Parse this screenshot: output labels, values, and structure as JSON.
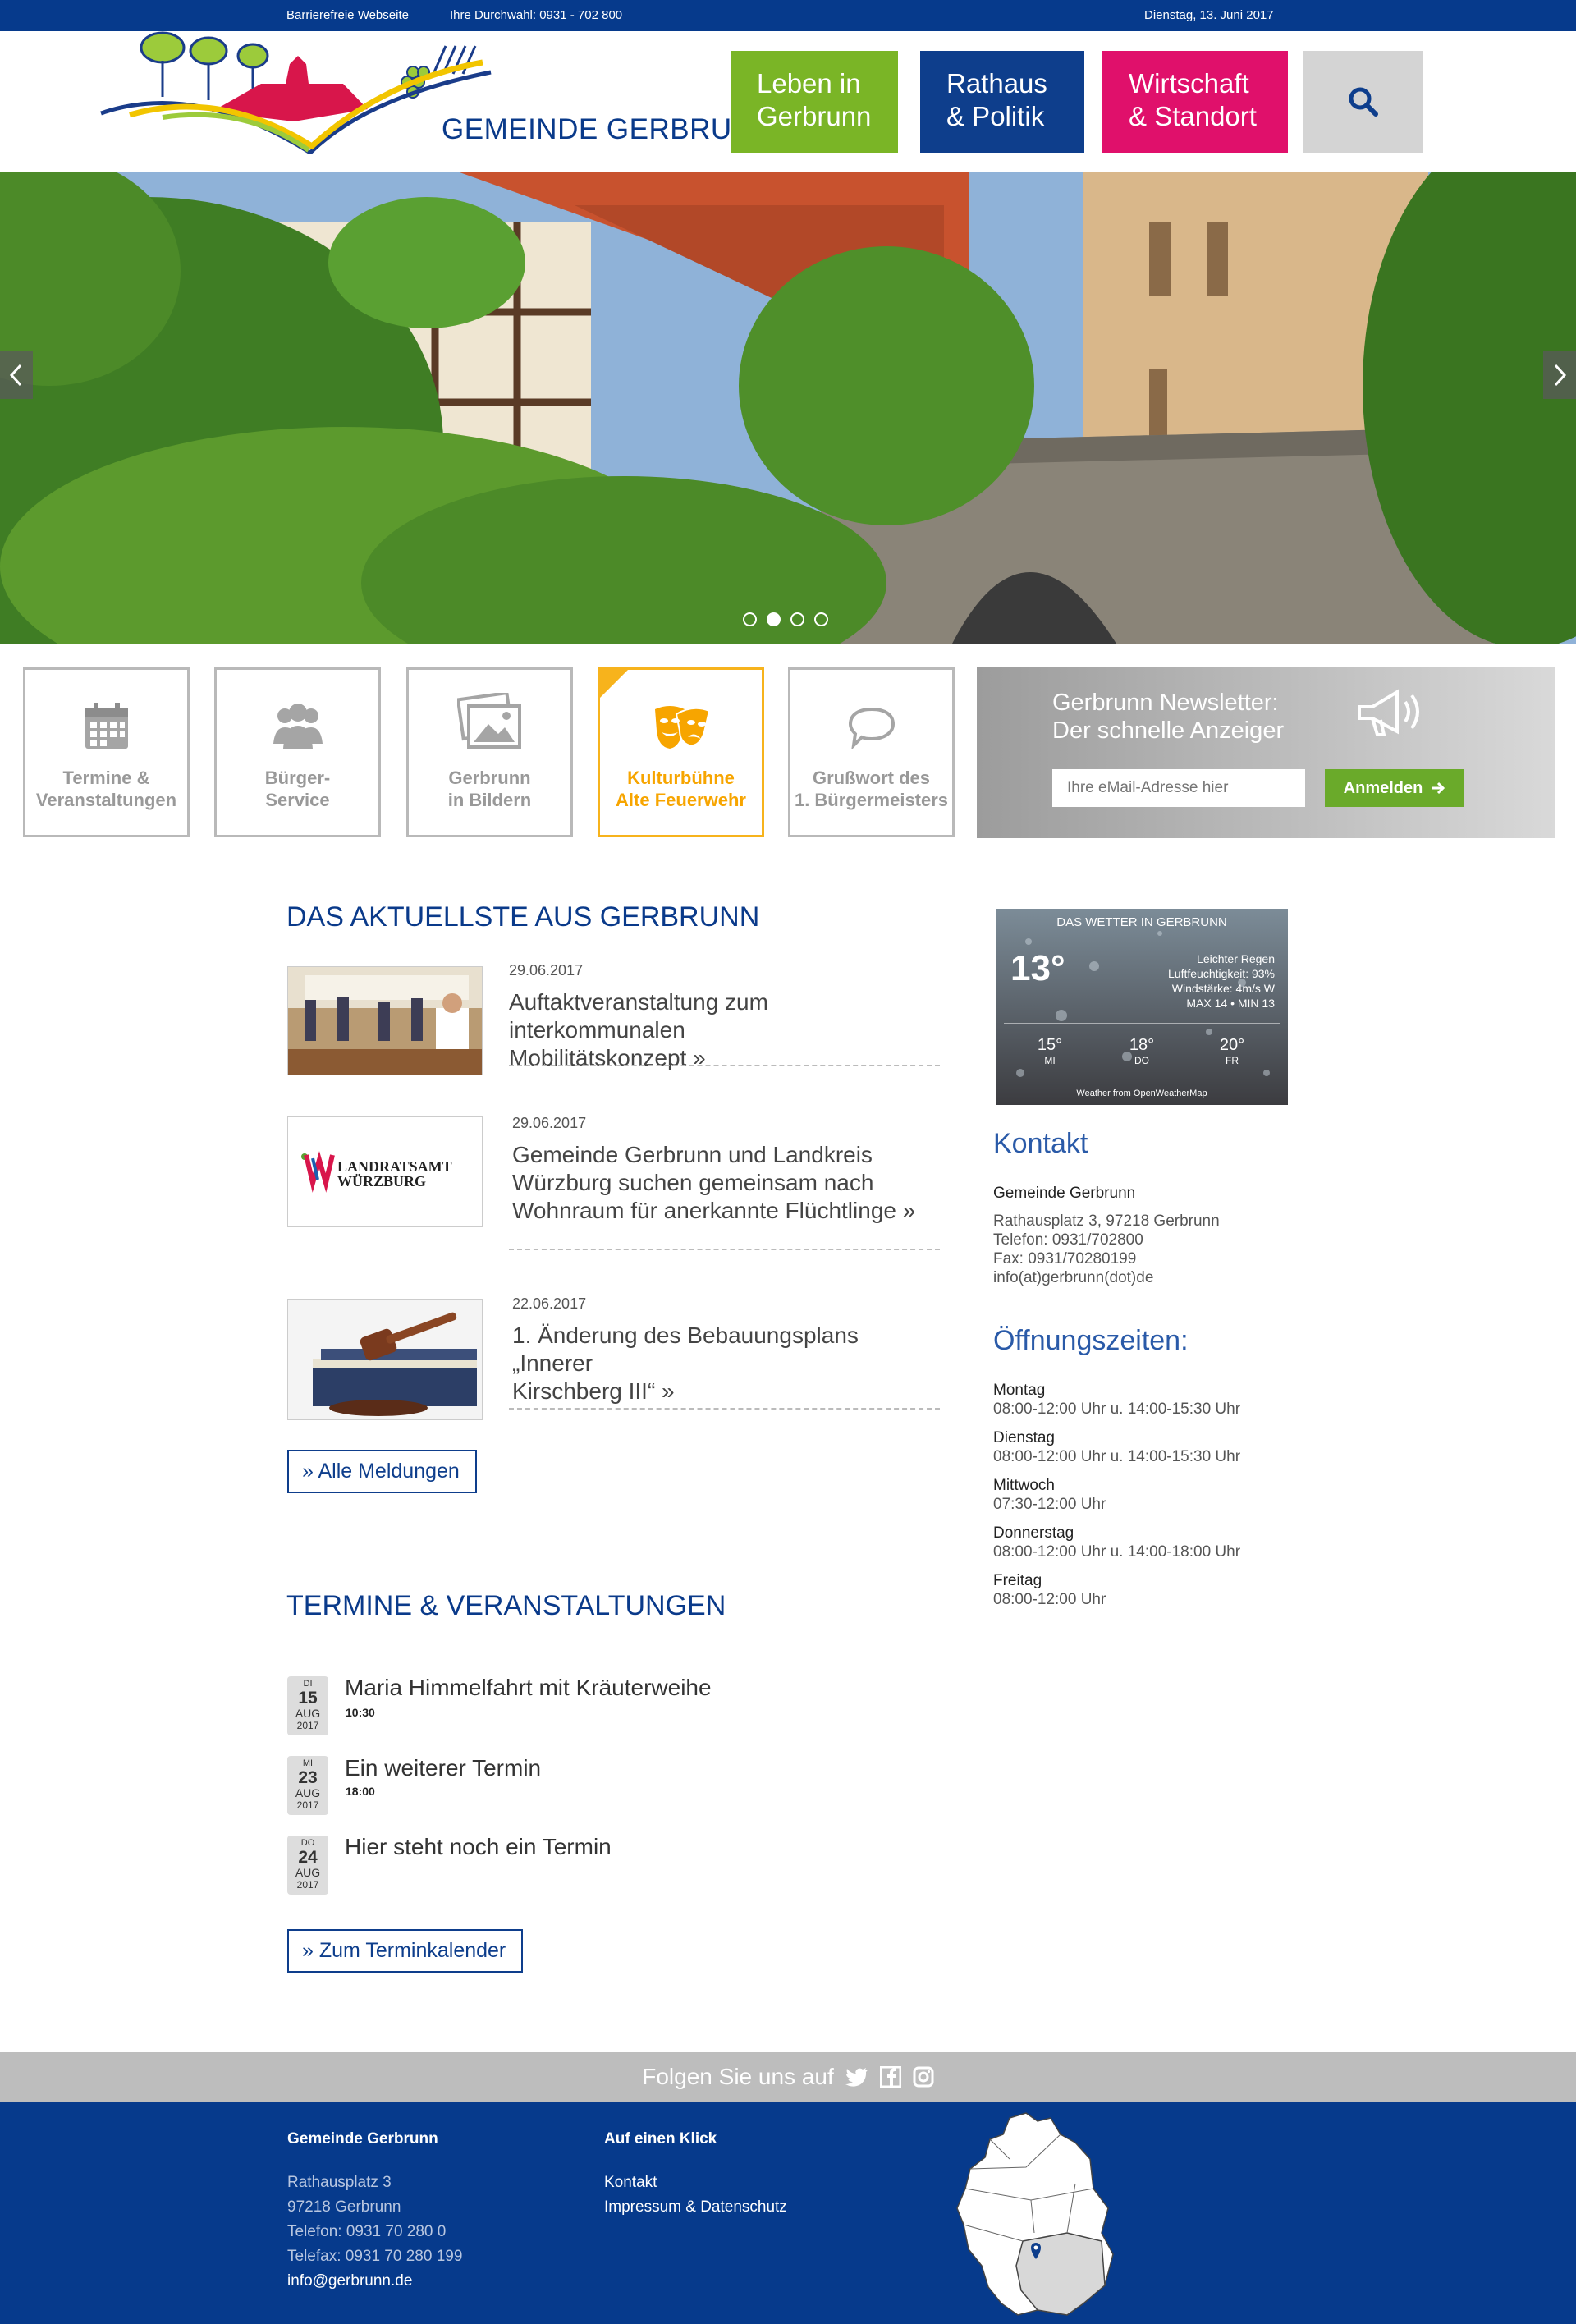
{
  "topbar": {
    "accessible": "Barrierefreie  Webseite",
    "phone": "Ihre Durchwahl: 0931 - 702 800",
    "date": "Dienstag, 13. Juni 2017"
  },
  "header": {
    "logo_text": "GEMEINDE GERBRUNN",
    "nav": [
      {
        "line1": "Leben in",
        "line2": "Gerbrunn"
      },
      {
        "line1": "Rathaus",
        "line2": "& Politik"
      },
      {
        "line1": "Wirtschaft",
        "line2": "& Standort"
      }
    ],
    "search_icon": "search-icon"
  },
  "slider": {
    "slides": 4,
    "active": 2
  },
  "tiles": [
    {
      "line1": "Termine &",
      "line2": "Veranstaltungen",
      "icon": "calendar-icon"
    },
    {
      "line1": "Bürger-",
      "line2": "Service",
      "icon": "people-icon"
    },
    {
      "line1": "Gerbrunn",
      "line2": "in Bildern",
      "icon": "photos-icon"
    },
    {
      "line1": "Kulturbühne",
      "line2": "Alte Feuerwehr",
      "icon": "theater-masks-icon"
    },
    {
      "line1": "Grußwort des",
      "line2": "1. Bürgermeisters",
      "icon": "speech-bubble-icon"
    }
  ],
  "newsletter": {
    "title1": "Gerbrunn Newsletter:",
    "title2": "Der schnelle Anzeiger",
    "placeholder": "Ihre eMail-Adresse hier",
    "button": "Anmelden"
  },
  "news": {
    "heading": "DAS AKTUELLSTE AUS GERBRUNN",
    "items": [
      {
        "date": "29.06.2017",
        "line1": "Auftaktveranstaltung zum interkommunalen",
        "line2": "Mobilitätskonzept »",
        "line3": ""
      },
      {
        "date": "29.06.2017",
        "line1": "Gemeinde Gerbrunn und Landkreis",
        "line2": "Würzburg suchen gemeinsam nach",
        "line3": "Wohnraum für anerkannte Flüchtlinge »",
        "logo_l1": "LANDRATSAMT",
        "logo_l2": "WÜRZBURG"
      },
      {
        "date": "22.06.2017",
        "line1": "1. Änderung des Bebauungsplans „Innerer",
        "line2": "Kirschberg III“  »",
        "line3": ""
      }
    ],
    "all_button": "» Alle Meldungen"
  },
  "events": {
    "heading": "TERMINE & VERANSTALTUNGEN",
    "items": [
      {
        "weekday": "DI",
        "day": "15",
        "month": "AUG",
        "year": "2017",
        "title": "Maria Himmelfahrt mit Kräuterweihe",
        "time": "10:30"
      },
      {
        "weekday": "MI",
        "day": "23",
        "month": "AUG",
        "year": "2017",
        "title": "Ein weiterer Termin",
        "time": "18:00"
      },
      {
        "weekday": "DO",
        "day": "24",
        "month": "AUG",
        "year": "2017",
        "title": "Hier steht noch ein Termin",
        "time": ""
      }
    ],
    "calendar_button": "» Zum Terminkalender"
  },
  "weather": {
    "title": "DAS WETTER IN GERBRUNN",
    "temp": "13°",
    "desc": "Leichter Regen",
    "humidity": "Luftfeuchtigkeit: 93%",
    "wind": "Windstärke: 4m/s W",
    "minmax": "MAX 14 • MIN 13",
    "forecast": [
      {
        "temp": "15°",
        "day": "MI"
      },
      {
        "temp": "18°",
        "day": "DO"
      },
      {
        "temp": "20°",
        "day": "FR"
      }
    ],
    "footer": "Weather from OpenWeatherMap"
  },
  "kontakt": {
    "heading": "Kontakt",
    "name": "Gemeinde Gerbrunn",
    "address": "Rathausplatz 3, 97218 Gerbrunn",
    "phone": "Telefon: 0931/702800",
    "fax": "Fax: 0931/70280199",
    "email": "info(at)gerbrunn(dot)de"
  },
  "hours": {
    "heading": "Öffnungszeiten:",
    "items": [
      {
        "day": "Montag",
        "time": "08:00-12:00 Uhr u. 14:00-15:30 Uhr"
      },
      {
        "day": "Dienstag",
        "time": "08:00-12:00 Uhr u. 14:00-15:30 Uhr"
      },
      {
        "day": "Mittwoch",
        "time": "07:30-12:00 Uhr"
      },
      {
        "day": "Donnerstag",
        "time": "08:00-12:00 Uhr u. 14:00-18:00 Uhr"
      },
      {
        "day": "Freitag",
        "time": "08:00-12:00 Uhr"
      }
    ]
  },
  "follow": {
    "label": "Folgen Sie uns auf"
  },
  "footer": {
    "col1_heading": "Gemeinde Gerbrunn",
    "street": "Rathausplatz 3",
    "city": "97218 Gerbrunn",
    "phone": "Telefon: 0931 70 280 0",
    "fax": "Telefax: 0931 70 280 199",
    "email": "info@gerbrunn.de",
    "col2_heading": "Auf einen Klick",
    "link1": "Kontakt",
    "link2": "Impressum & Datenschutz"
  },
  "colors": {
    "brand_blue": "#063a8c",
    "green": "#7ab526",
    "pink": "#e0106b",
    "accent_orange": "#f7b31c"
  }
}
